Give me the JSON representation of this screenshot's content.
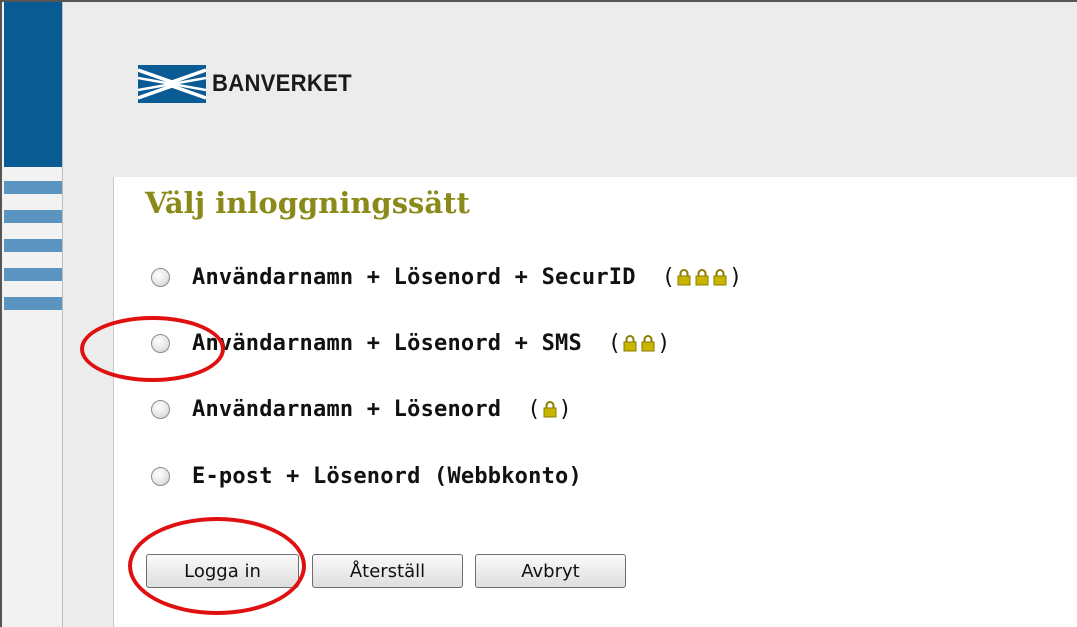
{
  "brand": {
    "name": "BANVERKET"
  },
  "page": {
    "title": "Välj inloggningssätt"
  },
  "options": [
    {
      "label": "Användarnamn + Lösenord + SecurID",
      "locks": 3
    },
    {
      "label": "Användarnamn + Lösenord + SMS",
      "locks": 2
    },
    {
      "label": "Användarnamn + Lösenord",
      "locks": 1
    },
    {
      "label": "E-post + Lösenord (Webbkonto)",
      "locks": 0
    }
  ],
  "buttons": {
    "login": "Logga in",
    "reset": "Återställ",
    "cancel": "Avbryt"
  },
  "icons": {
    "lock": "padlock-icon",
    "logo": "banverket-logo-icon"
  },
  "colors": {
    "title": "#8a8a1a",
    "sidebar_blue": "#0a5a93",
    "annotation": "#e01010",
    "lock": "#c9b400"
  }
}
